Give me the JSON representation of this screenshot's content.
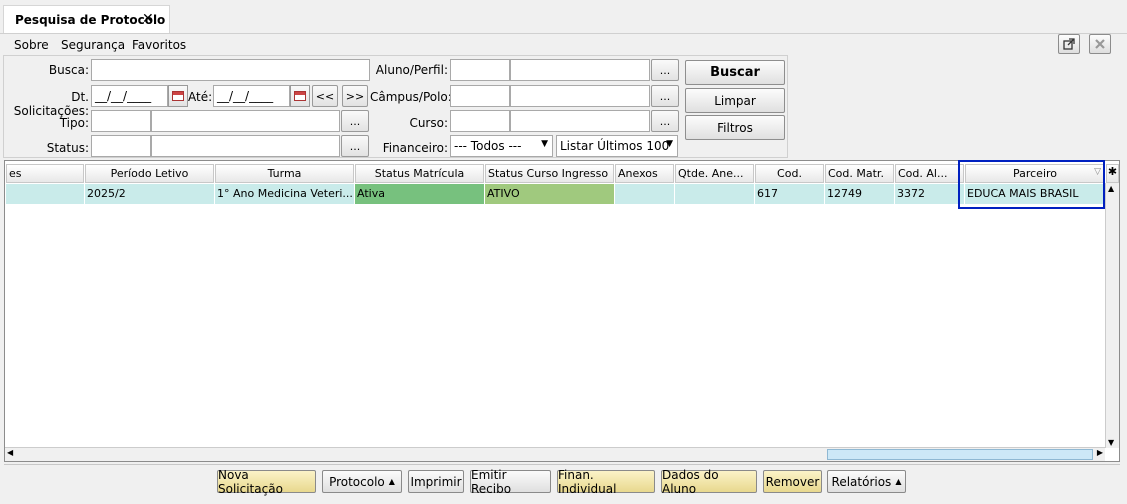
{
  "tab": {
    "title": "Pesquisa de Protocolo",
    "close": "✕"
  },
  "menu": {
    "items": [
      "Sobre",
      "Segurança",
      "Favoritos"
    ]
  },
  "form": {
    "busca_label": "Busca:",
    "dt_label": "Dt. Solicitações:",
    "dt_from": "__/__/____",
    "ate_label": "Até:",
    "dt_to": "__/__/____",
    "prev": "<<",
    "next": ">>",
    "tipo_label": "Tipo:",
    "status_label": "Status:",
    "aluno_label": "Aluno/Perfil:",
    "campus_label": "Câmpus/Polo:",
    "curso_label": "Curso:",
    "financeiro_label": "Financeiro:",
    "financeiro_value": "--- Todos ---",
    "listar_value": "Listar Últimos 100",
    "ellipsis": "..."
  },
  "actions": {
    "buscar": "Buscar",
    "limpar": "Limpar",
    "filtros": "Filtros"
  },
  "grid": {
    "columns": [
      "es",
      "Período Letivo",
      "Turma",
      "Status Matrícula",
      "Status Curso Ingresso",
      "Anexos",
      "Qtde. Ane...",
      "Cod.",
      "Cod. Matr.",
      "Cod. Al...",
      "Parceiro"
    ],
    "rows": [
      [
        "",
        "2025/2",
        "1°  Ano Medicina Veteri...",
        "Ativa",
        "ATIVO",
        "",
        "",
        "617",
        "12749",
        "3372",
        "EDUCA MAIS BRASIL"
      ]
    ],
    "status_matricula_color": "#77c17e",
    "status_curso_color": "#a0c97e",
    "row_color": "#c9ebea",
    "highlight_color": "#0020c0"
  },
  "bottom": {
    "buttons": [
      "Nova Solicitação",
      "Protocolo",
      "Imprimir",
      "Emitir Recibo",
      "Finan. Individual",
      "Dados do Aluno",
      "Remover",
      "Relatórios"
    ]
  }
}
